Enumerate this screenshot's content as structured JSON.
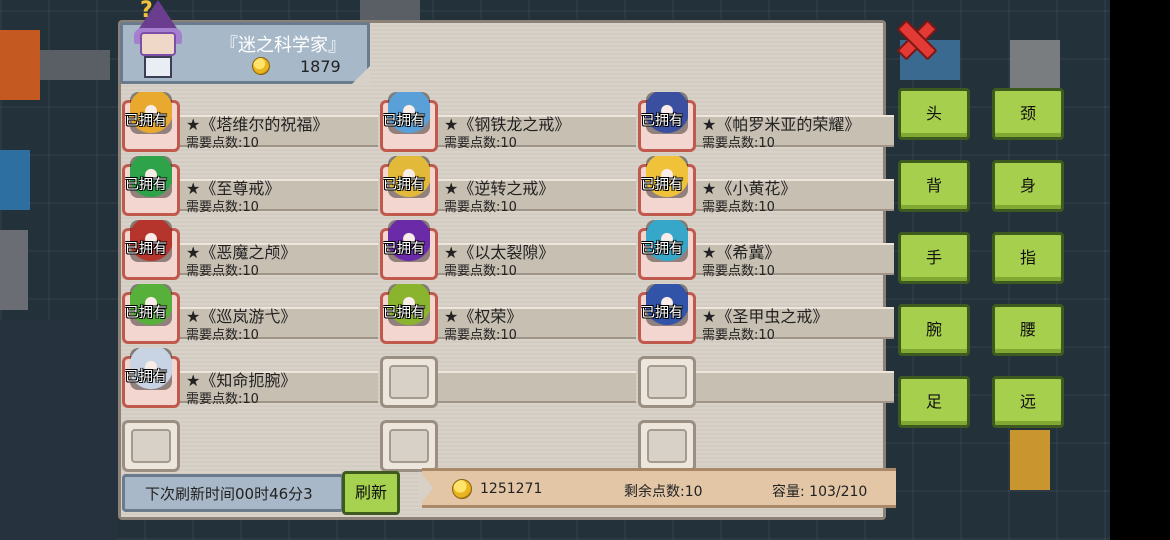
{
  "character": {
    "title": "『迷之科学家』",
    "coins": "1879"
  },
  "owned_label": "已拥有",
  "items": [
    {
      "name": "★《塔维尔的祝福》",
      "req": "需要点数:10",
      "owned": true,
      "color": "#e8a92e"
    },
    {
      "name": "★《钢铁龙之戒》",
      "req": "需要点数:10",
      "owned": true,
      "color": "#5aa0d8"
    },
    {
      "name": "★《帕罗米亚的荣耀》",
      "req": "需要点数:10",
      "owned": true,
      "color": "#3b4fa0"
    },
    {
      "name": "★《至尊戒》",
      "req": "需要点数:10",
      "owned": true,
      "color": "#2ea34a"
    },
    {
      "name": "★《逆转之戒》",
      "req": "需要点数:10",
      "owned": true,
      "color": "#e3b93a"
    },
    {
      "name": "★《小黄花》",
      "req": "需要点数:10",
      "owned": true,
      "color": "#f0c23a"
    },
    {
      "name": "★《恶魔之颅》",
      "req": "需要点数:10",
      "owned": true,
      "color": "#b5342c"
    },
    {
      "name": "★《以太裂隙》",
      "req": "需要点数:10",
      "owned": true,
      "color": "#6b2aa8"
    },
    {
      "name": "★《希冀》",
      "req": "需要点数:10",
      "owned": true,
      "color": "#36a7c9"
    },
    {
      "name": "★《巡岚游弋》",
      "req": "需要点数:10",
      "owned": true,
      "color": "#57b03a"
    },
    {
      "name": "★《权荣》",
      "req": "需要点数:10",
      "owned": true,
      "color": "#8bb42e"
    },
    {
      "name": "★《圣甲虫之戒》",
      "req": "需要点数:10",
      "owned": true,
      "color": "#3153a8"
    },
    {
      "name": "★《知命扼腕》",
      "req": "需要点数:10",
      "owned": true,
      "color": "#c8d4e4"
    }
  ],
  "footer": {
    "refresh_time": "下次刷新时间00时46分3",
    "refresh_button": "刷新",
    "gold": "1251271",
    "points": "剩余点数:10",
    "capacity": "容量:  103/210"
  },
  "categories": [
    "头",
    "颈",
    "背",
    "身",
    "手",
    "指",
    "腕",
    "腰",
    "足",
    "远"
  ],
  "colors": {
    "category_green": "#a5cf4d",
    "owned_red": "#c05a4f",
    "close_red": "#e33a35"
  }
}
